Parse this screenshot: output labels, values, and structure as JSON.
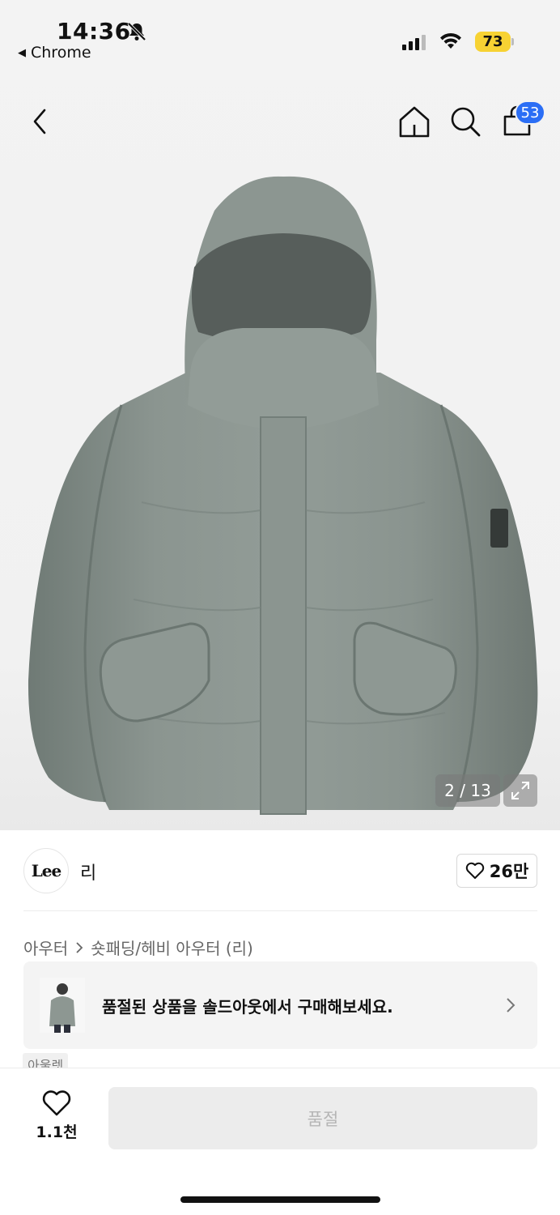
{
  "status_bar": {
    "time": "14:36",
    "back_app": "Chrome",
    "battery": "73",
    "icons": [
      "bell-slash-icon",
      "signal-icon",
      "wifi-icon",
      "battery-icon"
    ]
  },
  "nav": {
    "icons": [
      "chevron-left-icon",
      "home-icon",
      "search-icon",
      "cart-icon"
    ],
    "cart_count": "53"
  },
  "gallery": {
    "counter": "2 / 13",
    "expand_icon": "expand-icon"
  },
  "brand": {
    "logo_text": "Lee",
    "name": "리",
    "like_count": "26만"
  },
  "breadcrumb": {
    "category": "아우터",
    "subcategory": "숏패딩/헤비 아우터 (리)"
  },
  "soldout_card": {
    "text": "품절된 상품을 솔드아웃에서 구매해보세요."
  },
  "tag": {
    "outlet": "아울렛"
  },
  "bottom": {
    "wish_count": "1.1천",
    "buy_label": "품절"
  },
  "colors": {
    "badge": "#2b6ef5",
    "battery": "#f7d233",
    "jacket": "#8a948f"
  }
}
